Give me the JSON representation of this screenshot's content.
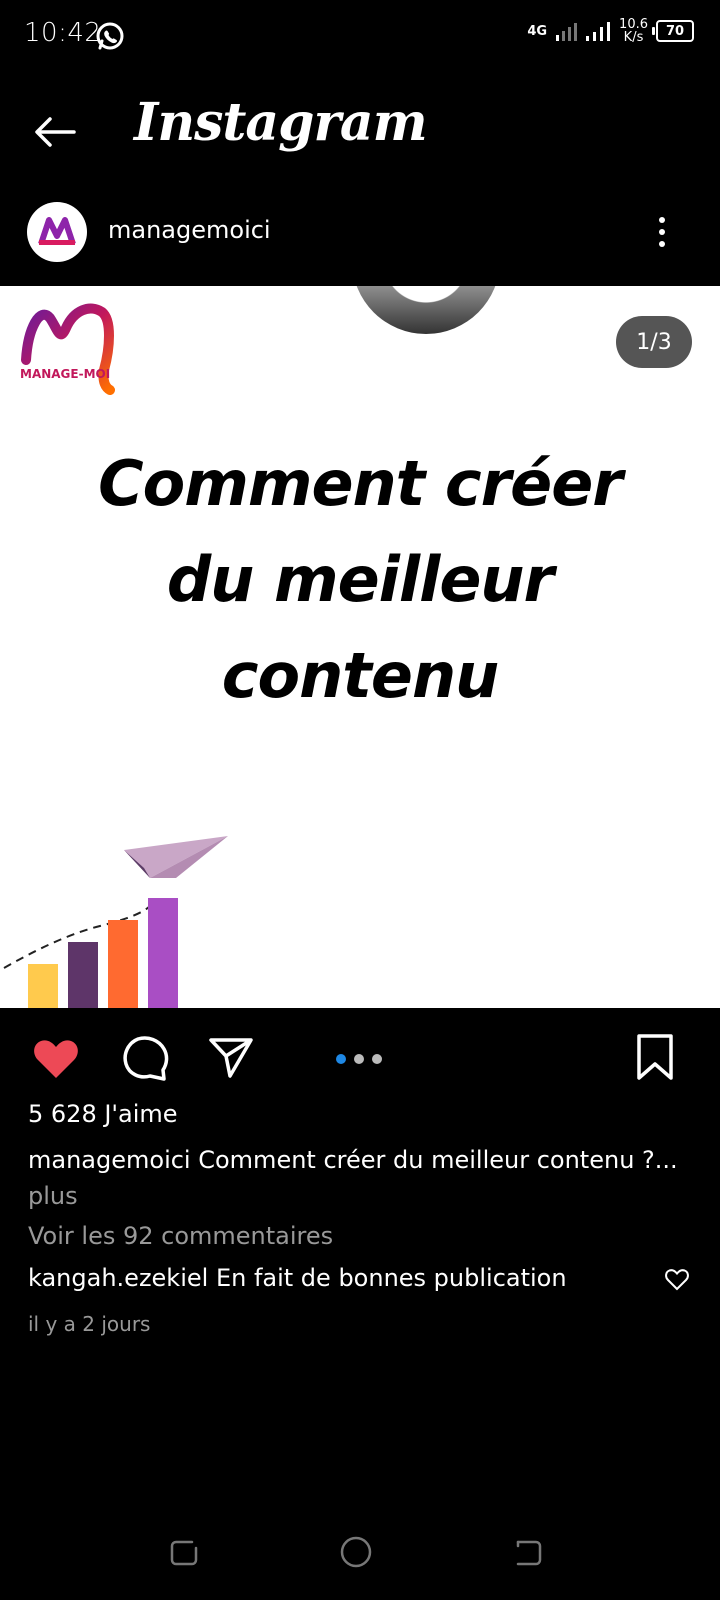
{
  "status_bar": {
    "time": "10:42",
    "network": "4G",
    "speed_top": "10.6",
    "speed_bottom": "K/s",
    "battery": "70"
  },
  "header": {
    "title": "Instagram"
  },
  "post": {
    "username": "managemoici",
    "counter": "1/3",
    "logo_text": "MANAGE-MOI",
    "headline_lines": [
      "Comment créer",
      "du meilleur",
      "contenu"
    ],
    "likes": "5 628 J'aime",
    "caption_user": "managemoici",
    "caption_text": " Comment créer du meilleur contenu ?...",
    "caption_more": "plus",
    "view_comments": "Voir les 92 commentaires",
    "comment_user": "kangah.ezekiel",
    "comment_text": " En fait de bonnes publication",
    "timestamp": "il y a 2 jours"
  },
  "colors": {
    "background": "#000000",
    "like_red": "#ED4956",
    "dot_active": "#1E88E5",
    "muted_text": "#999999"
  },
  "icons": [
    "whatsapp-icon",
    "back-arrow-icon",
    "more-vertical-icon",
    "heart-icon",
    "comment-icon",
    "share-icon",
    "bookmark-icon",
    "small-heart-icon",
    "nav-recents-icon",
    "nav-home-icon",
    "nav-back-icon"
  ]
}
